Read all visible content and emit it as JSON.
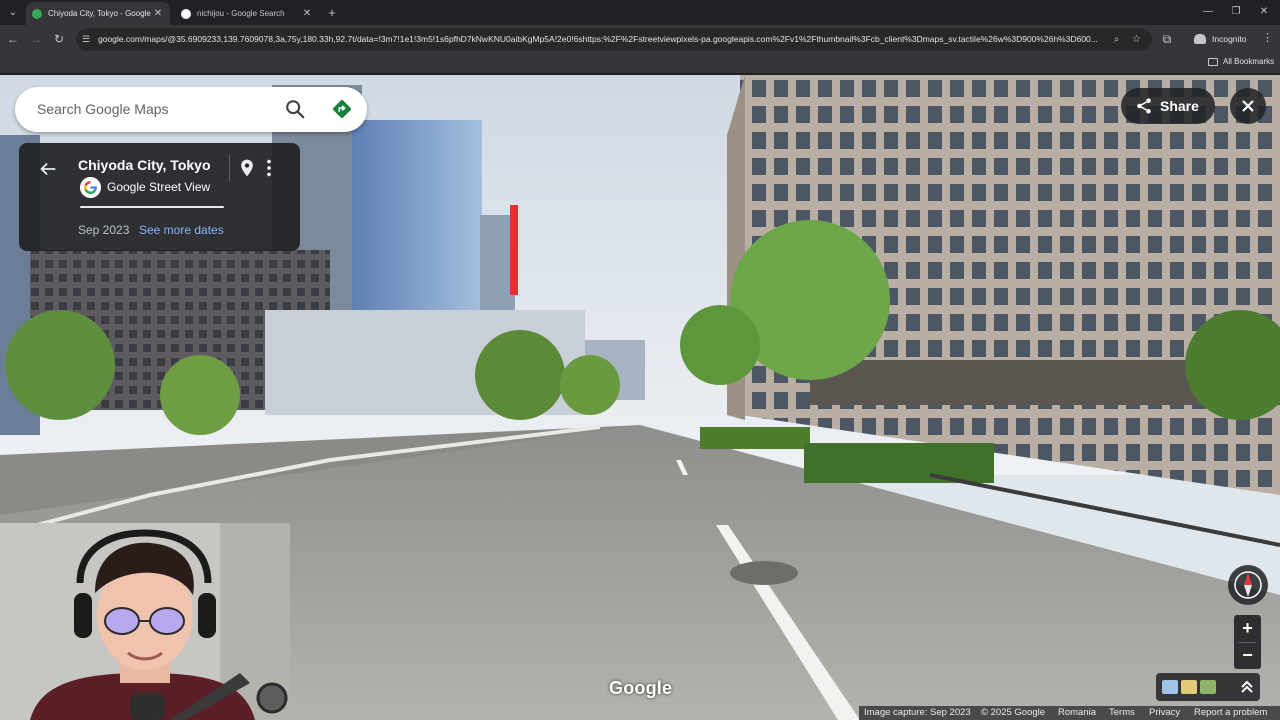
{
  "browser": {
    "tabs": [
      {
        "title": "Chiyoda City, Tokyo - Google Maps",
        "active": true,
        "icon": "maps-pin-icon"
      },
      {
        "title": "nichijou - Google Search",
        "active": false,
        "icon": "google-icon"
      }
    ],
    "url": "google.com/maps/@35.6909233,139.7609078,3a,75y,180.33h,92.7t/data=!3m7!1e1!3m5!1s6pfhD7kNwKNU0aibKgMp5A!2e0!6shttps:%2F%2Fstreetviewpixels-pa.googleapis.com%2Fv1%2Fthumbnail%3Fcb_client%3Dmaps_sv.tactile%26w%3D900%26h%3D600...",
    "profile_label": "Incognito",
    "bookmarks_label": "All Bookmarks"
  },
  "maps": {
    "search_placeholder": "Search Google Maps",
    "place_title": "Chiyoda City, Tokyo",
    "source_label": "Google Street View",
    "capture_date": "Sep 2023",
    "more_dates_label": "See more dates",
    "share_label": "Share",
    "watermark": "Google",
    "zoom_in": "+",
    "zoom_out": "−"
  },
  "footer": {
    "image_capture": "Image capture: Sep 2023",
    "copyright": "© 2025 Google",
    "region": "Romania",
    "terms": "Terms",
    "privacy": "Privacy",
    "report": "Report a problem"
  },
  "colors": {
    "directions": "#188038",
    "link": "#8ab4f8",
    "compass_north": "#e53935"
  }
}
